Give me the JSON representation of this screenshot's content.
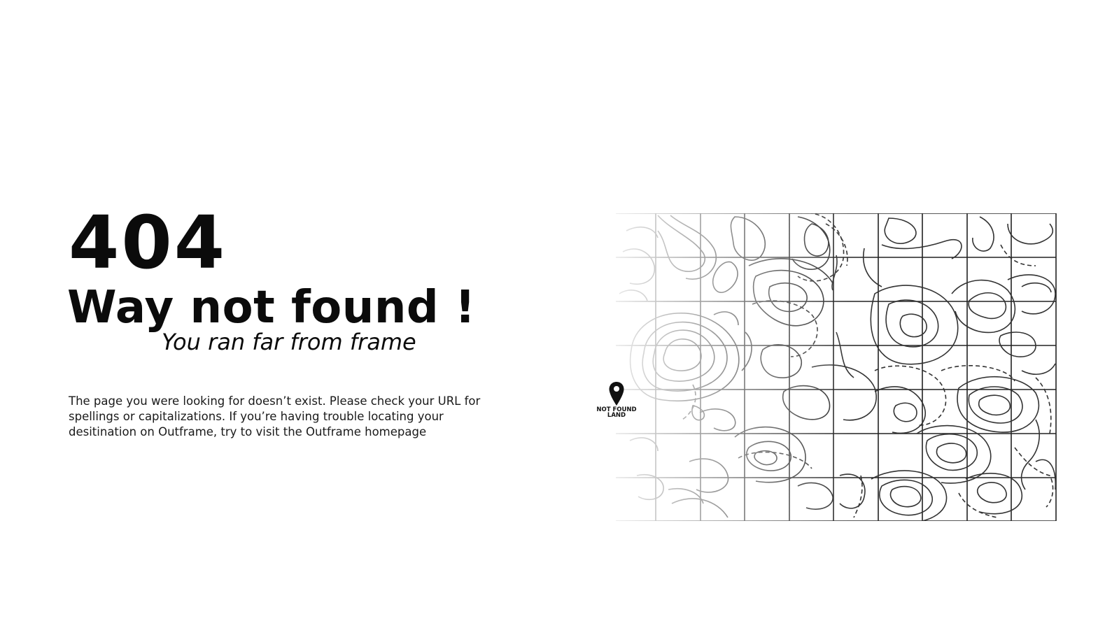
{
  "error": {
    "code": "404",
    "headline": "Way not found !",
    "tagline": "You ran far from frame",
    "body": "The page you were looking for doesn’t exist. Please check your URL for spellings or capitalizations. If you’re having trouble locating your desitination on Outframe, try to visit the Outframe homepage"
  },
  "map": {
    "pin_icon": "map-pin-icon",
    "pin_label_line1": "NOT FOUND",
    "pin_label_line2": "LAND"
  }
}
